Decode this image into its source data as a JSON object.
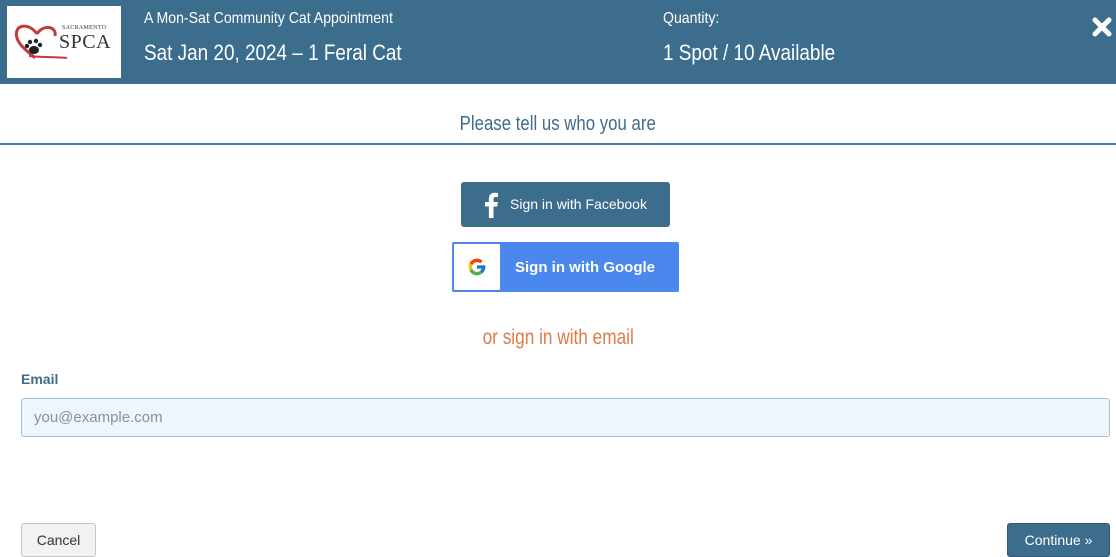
{
  "header": {
    "logo": {
      "small_text": "SACRAMENTO",
      "big_text": "SPCA"
    },
    "appointment_title": "A Mon-Sat Community Cat Appointment",
    "appointment_date": "Sat Jan 20, 2024 – 1 Feral Cat",
    "quantity_label": "Quantity:",
    "quantity_value": "1 Spot / 10 Available",
    "close_icon": "close-icon"
  },
  "signin": {
    "heading": "Please tell us who you are",
    "facebook_label": "Sign in with Facebook",
    "google_label": "Sign in with Google",
    "or_email": "or sign in with email"
  },
  "form": {
    "email_label": "Email",
    "email_value": "",
    "email_placeholder": "you@example.com"
  },
  "footer": {
    "cancel_label": "Cancel",
    "continue_label": "Continue »"
  },
  "colors": {
    "brand": "#3d6d8c",
    "google_blue": "#4b88ee",
    "accent_orange": "#e07a48"
  }
}
